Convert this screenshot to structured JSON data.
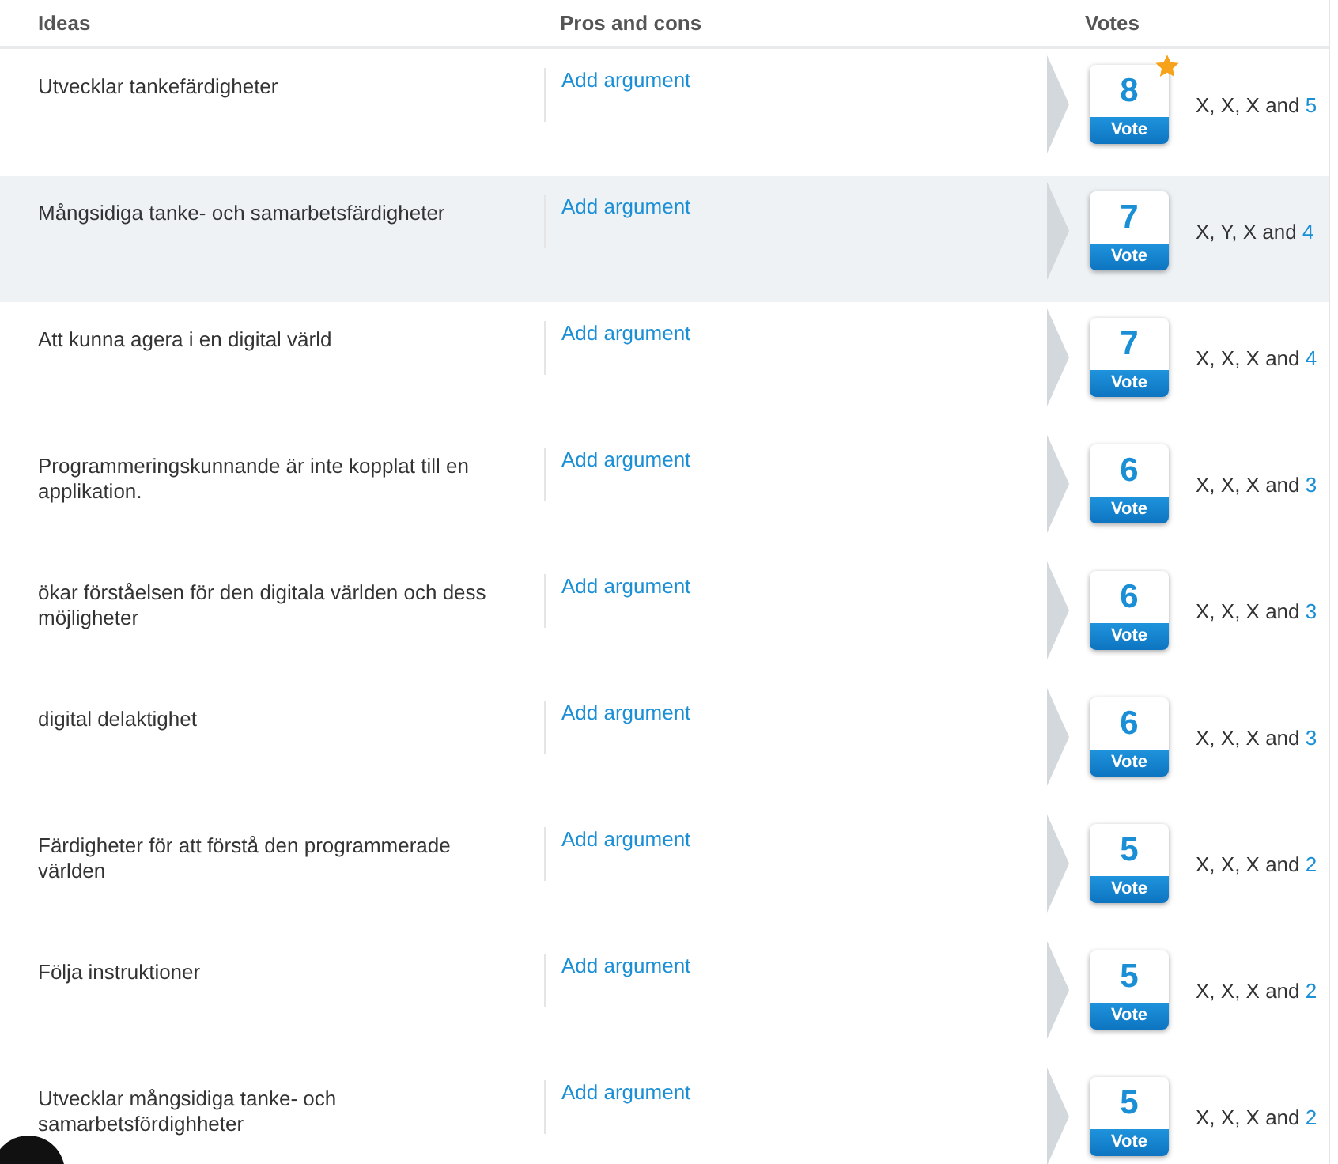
{
  "columns": [
    "Ideas",
    "Pros and cons",
    "Votes"
  ],
  "rows": [
    {
      "idea": "Utvecklar tankefärdigheter",
      "action": "Add argument",
      "votes": "8",
      "vote_label": "Vote",
      "starred": true,
      "selected": false,
      "voters": "X, X, X and",
      "more": "5"
    },
    {
      "idea": "Mångsidiga tanke- och samarbetsfärdigheter",
      "action": "Add argument",
      "votes": "7",
      "vote_label": "Vote",
      "starred": false,
      "selected": true,
      "voters": "X, Y, X and",
      "more": "4"
    },
    {
      "idea": "Att kunna agera i en digital värld",
      "action": "Add argument",
      "votes": "7",
      "vote_label": "Vote",
      "starred": false,
      "selected": false,
      "voters": "X, X, X and",
      "more": "4"
    },
    {
      "idea": "Programmeringskunnande är inte kopplat till en applikation.",
      "action": "Add argument",
      "votes": "6",
      "vote_label": "Vote",
      "starred": false,
      "selected": false,
      "voters": "X, X, X and",
      "more": "3"
    },
    {
      "idea": "ökar förståelsen för den digitala världen och dess möjligheter",
      "action": "Add argument",
      "votes": "6",
      "vote_label": "Vote",
      "starred": false,
      "selected": false,
      "voters": "X, X, X and",
      "more": "3"
    },
    {
      "idea": "digital delaktighet",
      "action": "Add argument",
      "votes": "6",
      "vote_label": "Vote",
      "starred": false,
      "selected": false,
      "voters": "X, X, X and",
      "more": "3"
    },
    {
      "idea": "Färdigheter för att förstå den programmerade världen",
      "action": "Add argument",
      "votes": "5",
      "vote_label": "Vote",
      "starred": false,
      "selected": false,
      "voters": "X, X, X and",
      "more": "2"
    },
    {
      "idea": "Följa instruktioner",
      "action": "Add argument",
      "votes": "5",
      "vote_label": "Vote",
      "starred": false,
      "selected": false,
      "voters": "X, X, X and",
      "more": "2"
    },
    {
      "idea": "Utvecklar mångsidiga tanke- och samarbetsfördighheter",
      "action": "Add argument",
      "votes": "5",
      "vote_label": "Vote",
      "starred": false,
      "selected": false,
      "voters": "X, X, X and",
      "more": "2"
    }
  ]
}
